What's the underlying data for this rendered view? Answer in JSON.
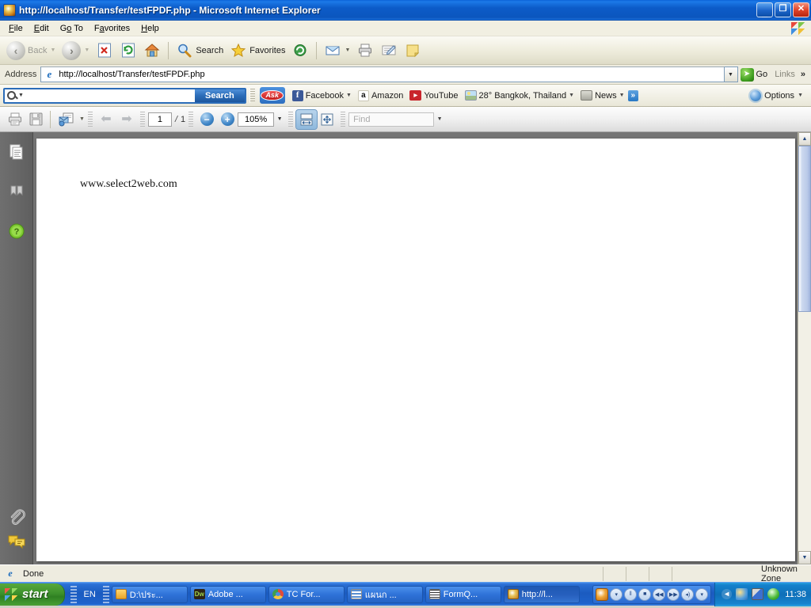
{
  "window": {
    "title": "http://localhost/Transfer/testFPDF.php - Microsoft Internet Explorer",
    "icon": "ie-document-icon",
    "minimize_label": "_",
    "restore_label": "❐",
    "close_label": "✕"
  },
  "menubar": {
    "items": [
      {
        "label": "File",
        "accel": "F"
      },
      {
        "label": "Edit",
        "accel": "E"
      },
      {
        "label": "Go To",
        "accel": "o"
      },
      {
        "label": "Favorites",
        "accel": "a"
      },
      {
        "label": "Help",
        "accel": "H"
      }
    ]
  },
  "ie_toolbar": {
    "back_label": "Back",
    "forward_label": "",
    "search_label": "Search",
    "favorites_label": "Favorites",
    "icons": [
      "back-icon",
      "forward-icon",
      "stop-icon",
      "refresh-icon",
      "home-icon",
      "search-icon",
      "favorites-icon",
      "history-icon",
      "mail-icon",
      "print-icon",
      "edit-icon",
      "notes-icon"
    ]
  },
  "address_bar": {
    "label": "Address",
    "url": "http://localhost/Transfer/testFPDF.php",
    "go_label": "Go",
    "links_label": "Links",
    "overflow_label": "»"
  },
  "ask_toolbar": {
    "search_value": "",
    "search_placeholder": "",
    "search_button": "Search",
    "brand": "Ask",
    "items": [
      {
        "label": "Facebook",
        "icon": "facebook-icon",
        "has_caret": true
      },
      {
        "label": "Amazon",
        "icon": "amazon-icon",
        "has_caret": false
      },
      {
        "label": "YouTube",
        "icon": "youtube-icon",
        "has_caret": false
      },
      {
        "label": "28° Bangkok, Thailand",
        "icon": "weather-icon",
        "has_caret": true
      },
      {
        "label": "News",
        "icon": "news-icon",
        "has_caret": true
      }
    ],
    "more_label": "»",
    "options_label": "Options",
    "options_icon": "gear-icon"
  },
  "pdf_toolbar": {
    "print_icon": "print-icon",
    "save_icon": "save-icon",
    "email_icon": "email-document-icon",
    "prev_icon": "arrow-left-icon",
    "next_icon": "arrow-right-icon",
    "page_current": "1",
    "page_separator": "/",
    "page_total": "1",
    "zoom_out_label": "−",
    "zoom_in_label": "+",
    "zoom_value": "105%",
    "fit_width_icon": "fit-width-icon",
    "fit_page_icon": "fit-page-icon",
    "find_placeholder": "Find",
    "find_value": ""
  },
  "pdf_sidebar": {
    "items": [
      {
        "name": "pages-panel-icon",
        "label": "Pages"
      },
      {
        "name": "bookmarks-panel-icon",
        "label": "Bookmarks"
      },
      {
        "name": "help-icon",
        "label": "Help"
      }
    ],
    "bottom_items": [
      {
        "name": "attachments-panel-icon",
        "label": "Attachments"
      },
      {
        "name": "comments-panel-icon",
        "label": "Comments"
      }
    ]
  },
  "pdf_document": {
    "body_text": "www.select2web.com"
  },
  "scrollbar": {
    "up_label": "▲",
    "down_label": "▼"
  },
  "statusbar": {
    "status_text": "Done",
    "zone_text": "Unknown Zone",
    "status_icon": "ie-icon"
  },
  "taskbar": {
    "start_label": "start",
    "language": "EN",
    "items": [
      {
        "label": "D:\\ประ...",
        "icon": "folder-icon",
        "active": false
      },
      {
        "label": "Adobe ...",
        "icon": "dreamweaver-icon",
        "active": false
      },
      {
        "label": "TC For...",
        "icon": "chrome-icon",
        "active": false
      },
      {
        "label": "แผนก ...",
        "icon": "spreadsheet-icon",
        "active": false
      },
      {
        "label": "FormQ...",
        "icon": "form-icon",
        "active": false
      },
      {
        "label": "http://l...",
        "icon": "ie-icon",
        "active": true
      }
    ],
    "media_controls": [
      {
        "name": "wmp-icon",
        "glyph": ""
      },
      {
        "name": "media-menu-button",
        "glyph": "▾"
      },
      {
        "name": "media-pause-button",
        "glyph": "‖"
      },
      {
        "name": "media-stop-button",
        "glyph": "■"
      },
      {
        "name": "media-previous-button",
        "glyph": "◀◀"
      },
      {
        "name": "media-next-button",
        "glyph": "▶▶"
      },
      {
        "name": "media-volume-button",
        "glyph": "◂)"
      },
      {
        "name": "media-volume-menu-button",
        "glyph": "▾"
      }
    ],
    "tray": {
      "chevron": "◂",
      "icons": [
        "paint-tray-icon",
        "network-tray-icon",
        "antivirus-tray-icon"
      ],
      "clock": "11:38"
    }
  }
}
